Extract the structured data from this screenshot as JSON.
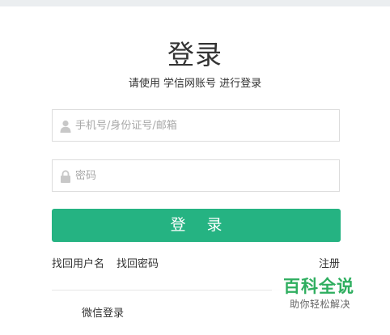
{
  "header": {
    "title": "登录",
    "subtitle": "请使用 学信网账号 进行登录"
  },
  "form": {
    "account_placeholder": "手机号/身份证号/邮箱",
    "password_placeholder": "密码",
    "account_icon": "user-icon",
    "password_icon": "lock-icon",
    "submit_label": "登 录"
  },
  "links": {
    "find_username": "找回用户名",
    "find_password": "找回密码",
    "register": "注册"
  },
  "wechat_login": "微信登录",
  "watermark": {
    "logo": "百科全说",
    "tagline": "助你轻松解决"
  },
  "colors": {
    "primary": "#25b382",
    "watermark": "#2eae5f"
  }
}
